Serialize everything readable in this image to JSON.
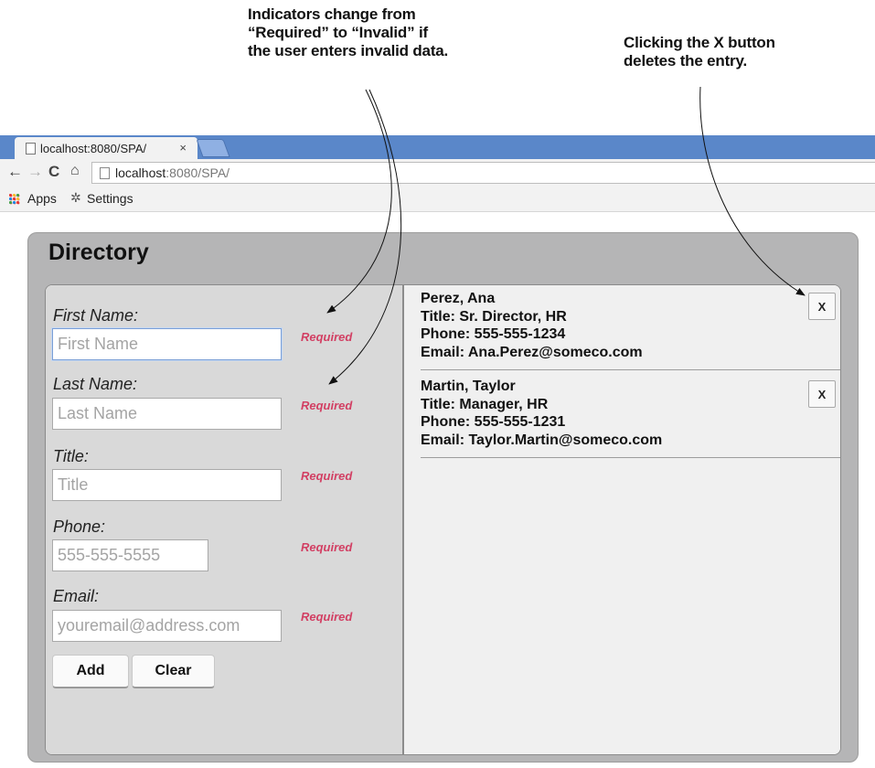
{
  "annotations": {
    "left_lines": [
      "Indicators change from",
      "“Required” to “Invalid” if",
      "the user enters invalid data."
    ],
    "right_lines": [
      "Clicking the X button",
      "deletes the entry."
    ]
  },
  "browser": {
    "tab_title": "localhost:8080/SPA/",
    "tab_close": "×",
    "url_host": "localhost",
    "url_path": ":8080/SPA/",
    "bookmarks": [
      {
        "label": "Apps",
        "icon": "apps-grid-icon"
      },
      {
        "label": "Settings",
        "icon": "gear-icon"
      }
    ]
  },
  "app": {
    "title": "Directory",
    "form": {
      "fields": [
        {
          "label": "First Name:",
          "placeholder": "First Name",
          "status": "Required"
        },
        {
          "label": "Last Name:",
          "placeholder": "Last Name",
          "status": "Required"
        },
        {
          "label": "Title:",
          "placeholder": "Title",
          "status": "Required"
        },
        {
          "label": "Phone:",
          "placeholder": "555-555-5555",
          "status": "Required"
        },
        {
          "label": "Email:",
          "placeholder": "youremail@address.com",
          "status": "Required"
        }
      ],
      "add_label": "Add",
      "clear_label": "Clear"
    },
    "entries": [
      {
        "name": "Perez, Ana",
        "title": "Title: Sr. Director, HR",
        "phone": "Phone: 555-555-1234",
        "email": "Email: Ana.Perez@someco.com",
        "delete_label": "X"
      },
      {
        "name": "Martin, Taylor",
        "title": "Title: Manager, HR",
        "phone": "Phone: 555-555-1231",
        "email": "Email: Taylor.Martin@someco.com",
        "delete_label": "X"
      }
    ]
  }
}
